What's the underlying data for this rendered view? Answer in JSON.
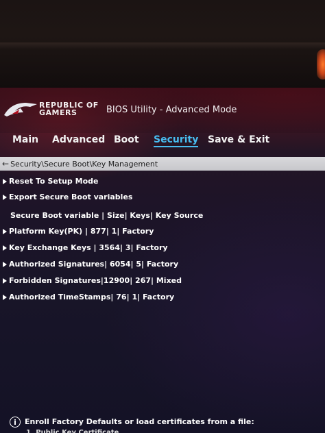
{
  "brand": {
    "line1": "REPUBLIC OF",
    "line2": "GAMERS"
  },
  "title": "BIOS Utility - Advanced Mode",
  "tabs": [
    {
      "label": "Main"
    },
    {
      "label": "Advanced"
    },
    {
      "label": "Boot"
    },
    {
      "label": "Security",
      "active": true
    },
    {
      "label": "Save & Exit"
    }
  ],
  "breadcrumb": {
    "back_icon": "back-arrow-icon",
    "path": "Security\\Secure Boot\\Key Management"
  },
  "actions": [
    {
      "label": "Reset To Setup Mode"
    },
    {
      "label": "Export Secure Boot variables"
    }
  ],
  "table_header": "Secure Boot variable | Size| Keys| Key Source",
  "rows": [
    {
      "label": "Platform Key(PK)  | 877|  1| Factory"
    },
    {
      "label": "Key Exchange Keys  | 3564|  3| Factory"
    },
    {
      "label": "Authorized Signatures| 6054|  5| Factory"
    },
    {
      "label": "Forbidden Signatures|12900| 267| Mixed"
    },
    {
      "label": "Authorized TimeStamps|  76|  1| Factory"
    }
  ],
  "help": {
    "icon": "info-icon",
    "text": "Enroll Factory Defaults or load certificates from a file:",
    "sub": "1. Public Key Certificate"
  },
  "colors": {
    "accent": "#48bdf0",
    "breadcrumb_bg": "#d2d2d5"
  }
}
